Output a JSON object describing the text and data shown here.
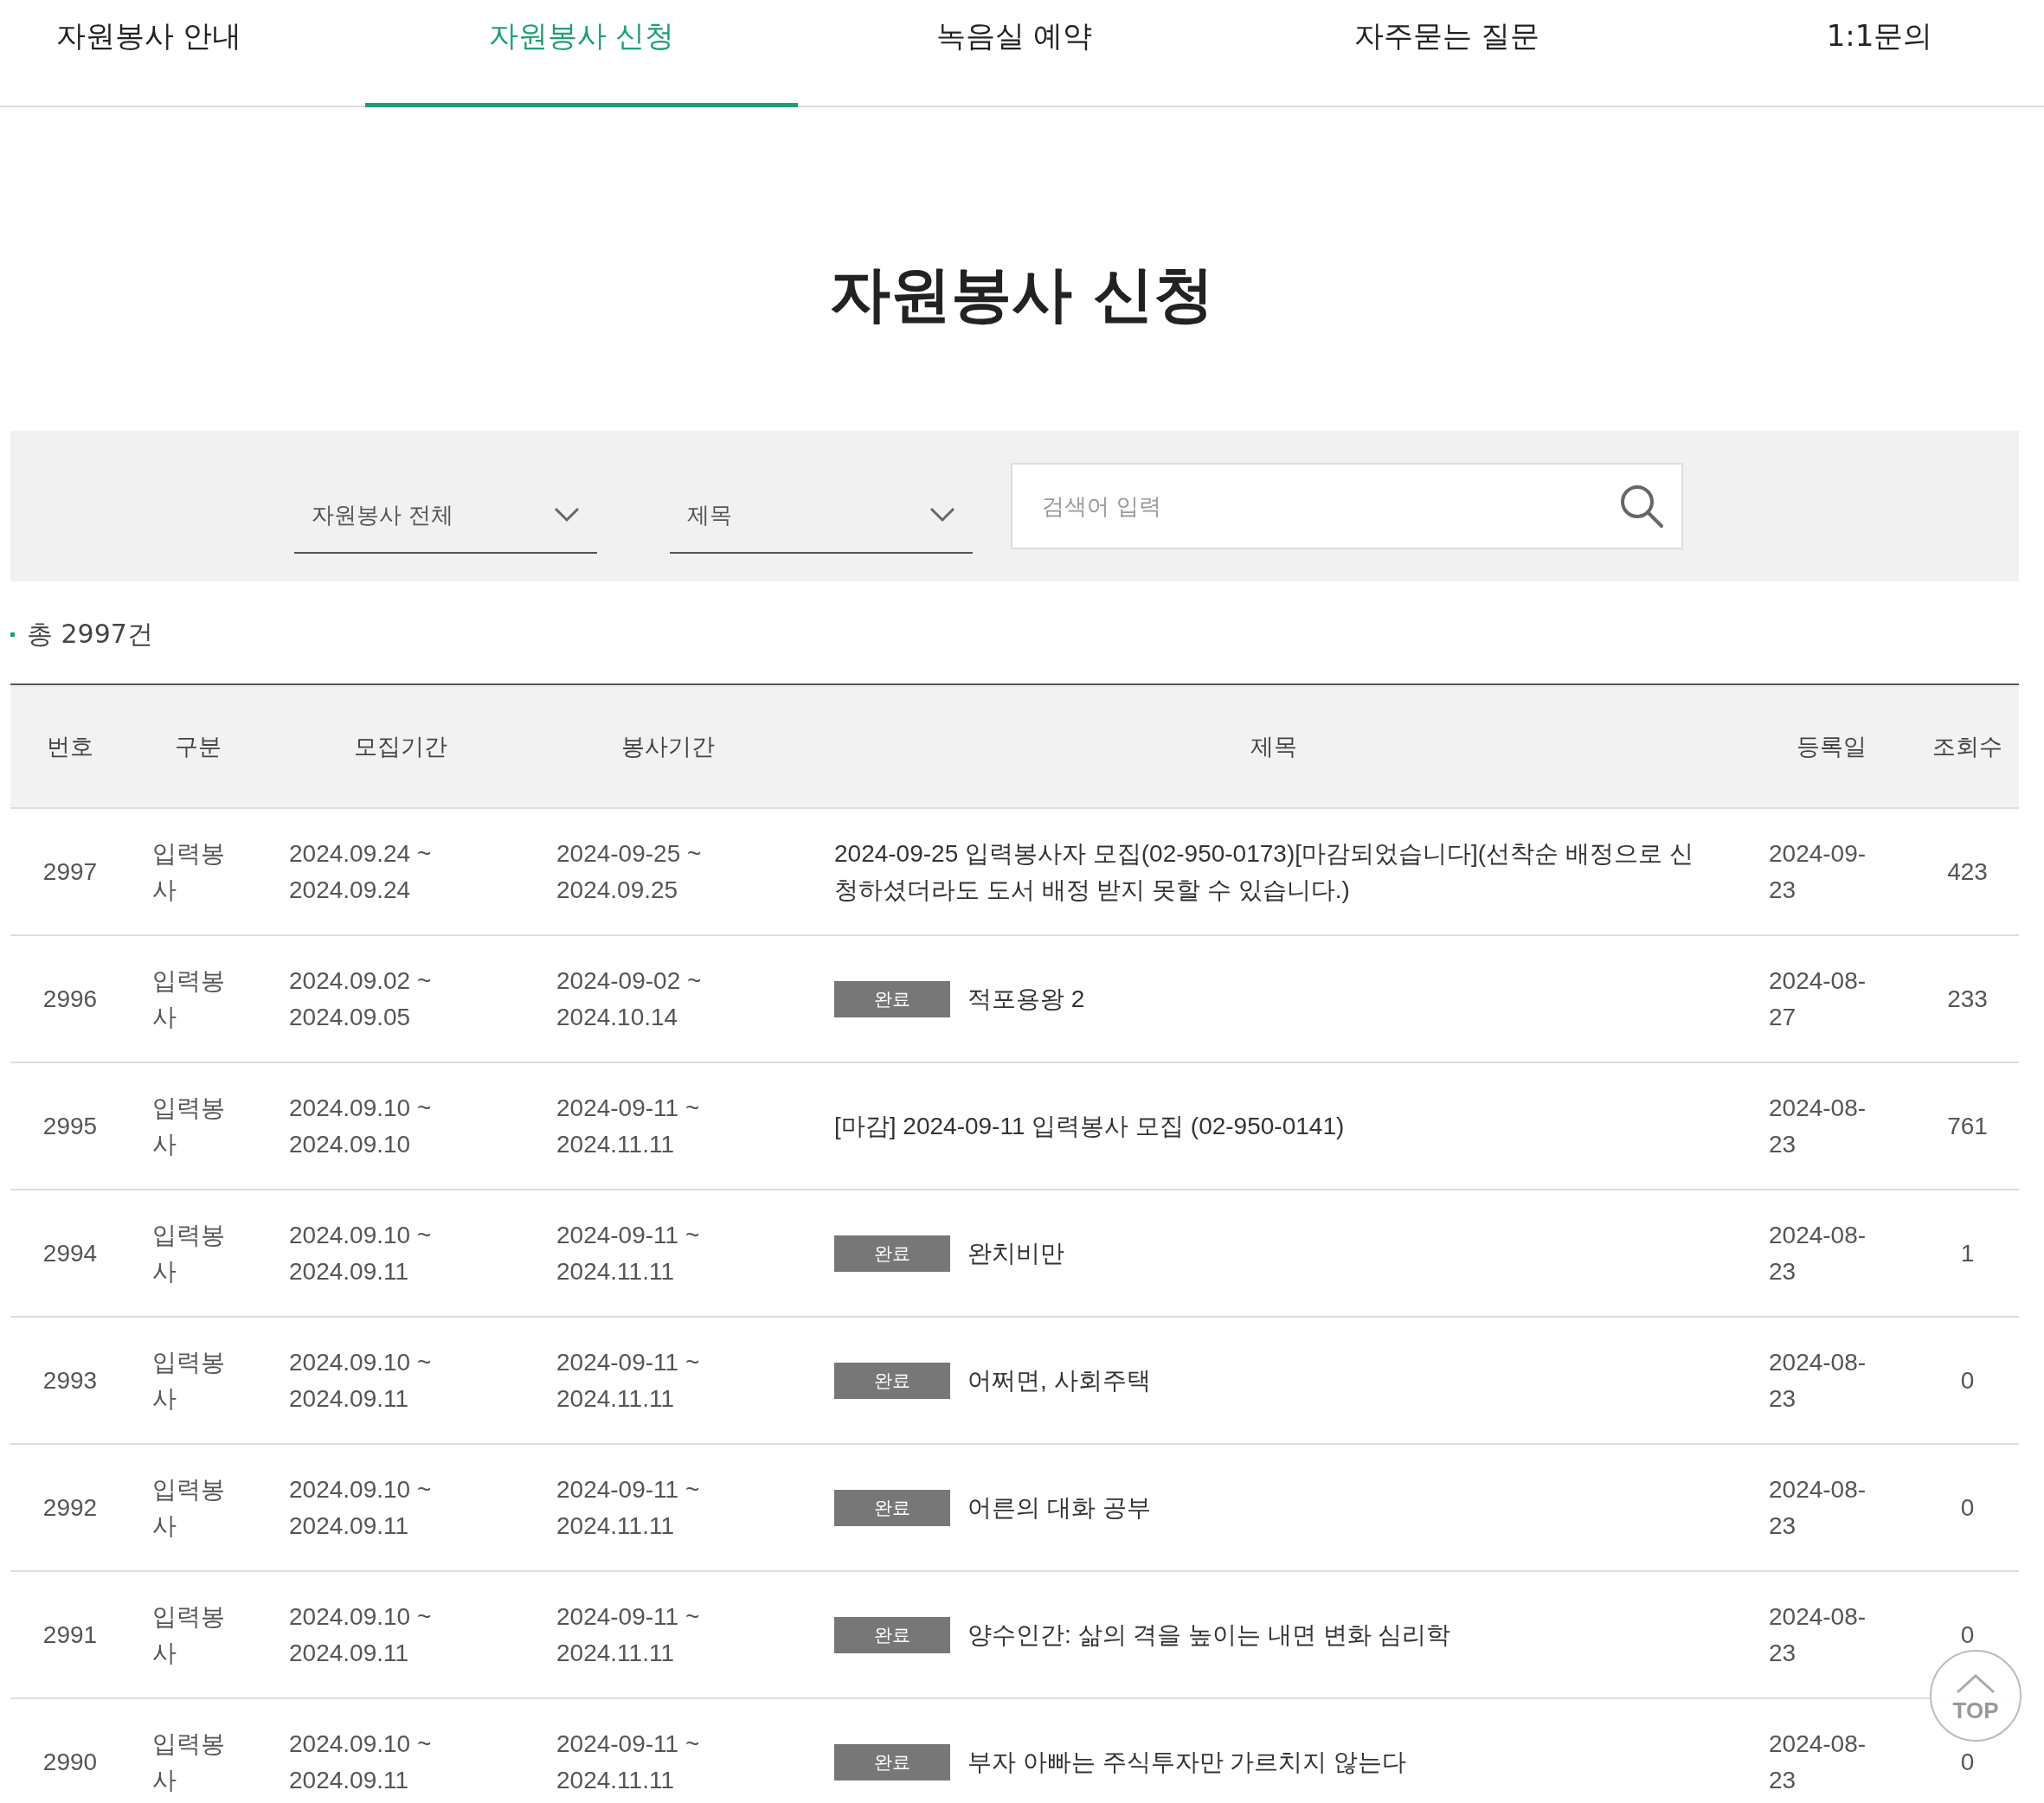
{
  "tabs": [
    {
      "label": "자원봉사 안내",
      "selected": false
    },
    {
      "label": "자원봉사 신청",
      "selected": true
    },
    {
      "label": "녹음실 예약",
      "selected": false
    },
    {
      "label": "자주묻는 질문",
      "selected": false
    },
    {
      "label": "1:1문의",
      "selected": false
    }
  ],
  "page_title": "자원봉사 신청",
  "filters": {
    "category": "자원봉사 전체",
    "field": "제목",
    "search": {
      "placeholder": "검색어 입력"
    }
  },
  "total": "총 2997건",
  "table": {
    "columns": [
      "번호",
      "구분",
      "모집기간",
      "봉사기간",
      "제목",
      "등록일",
      "조회수"
    ],
    "rows": [
      {
        "no": "2997",
        "type": "입력봉사",
        "recruit": "2024.09.24 ~ 2024.09.24",
        "service": "2024-09-25 ~ 2024.09.25",
        "badge": null,
        "title": "2024-09-25 입력봉사자 모집(02-950-0173)[마감되었습니다](선착순 배정으로 신청하셨더라도 도서 배정 받지 못할 수 있습니다.)",
        "date": "2024-09-23",
        "views": "423"
      },
      {
        "no": "2996",
        "type": "입력봉사",
        "recruit": "2024.09.02 ~ 2024.09.05",
        "service": "2024-09-02 ~ 2024.10.14",
        "badge": "완료",
        "title": "적포용왕 2",
        "date": "2024-08-27",
        "views": "233"
      },
      {
        "no": "2995",
        "type": "입력봉사",
        "recruit": "2024.09.10 ~ 2024.09.10",
        "service": "2024-09-11 ~ 2024.11.11",
        "badge": null,
        "title": "[마감] 2024-09-11 입력봉사 모집 (02-950-0141)",
        "date": "2024-08-23",
        "views": "761"
      },
      {
        "no": "2994",
        "type": "입력봉사",
        "recruit": "2024.09.10 ~ 2024.09.11",
        "service": "2024-09-11 ~ 2024.11.11",
        "badge": "완료",
        "title": "완치비만",
        "date": "2024-08-23",
        "views": "1"
      },
      {
        "no": "2993",
        "type": "입력봉사",
        "recruit": "2024.09.10 ~ 2024.09.11",
        "service": "2024-09-11 ~ 2024.11.11",
        "badge": "완료",
        "title": "어쩌면, 사회주택",
        "date": "2024-08-23",
        "views": "0"
      },
      {
        "no": "2992",
        "type": "입력봉사",
        "recruit": "2024.09.10 ~ 2024.09.11",
        "service": "2024-09-11 ~ 2024.11.11",
        "badge": "완료",
        "title": "어른의 대화 공부",
        "date": "2024-08-23",
        "views": "0"
      },
      {
        "no": "2991",
        "type": "입력봉사",
        "recruit": "2024.09.10 ~ 2024.09.11",
        "service": "2024-09-11 ~ 2024.11.11",
        "badge": "완료",
        "title": "양수인간: 삶의 격을 높이는 내면 변화 심리학",
        "date": "2024-08-23",
        "views": "0"
      },
      {
        "no": "2990",
        "type": "입력봉사",
        "recruit": "2024.09.10 ~ 2024.09.11",
        "service": "2024-09-11 ~ 2024.11.11",
        "badge": "완료",
        "title": "부자 아빠는 주식투자만 가르치지 않는다",
        "date": "2024-08-23",
        "views": "0"
      }
    ]
  },
  "top_button": "TOP"
}
